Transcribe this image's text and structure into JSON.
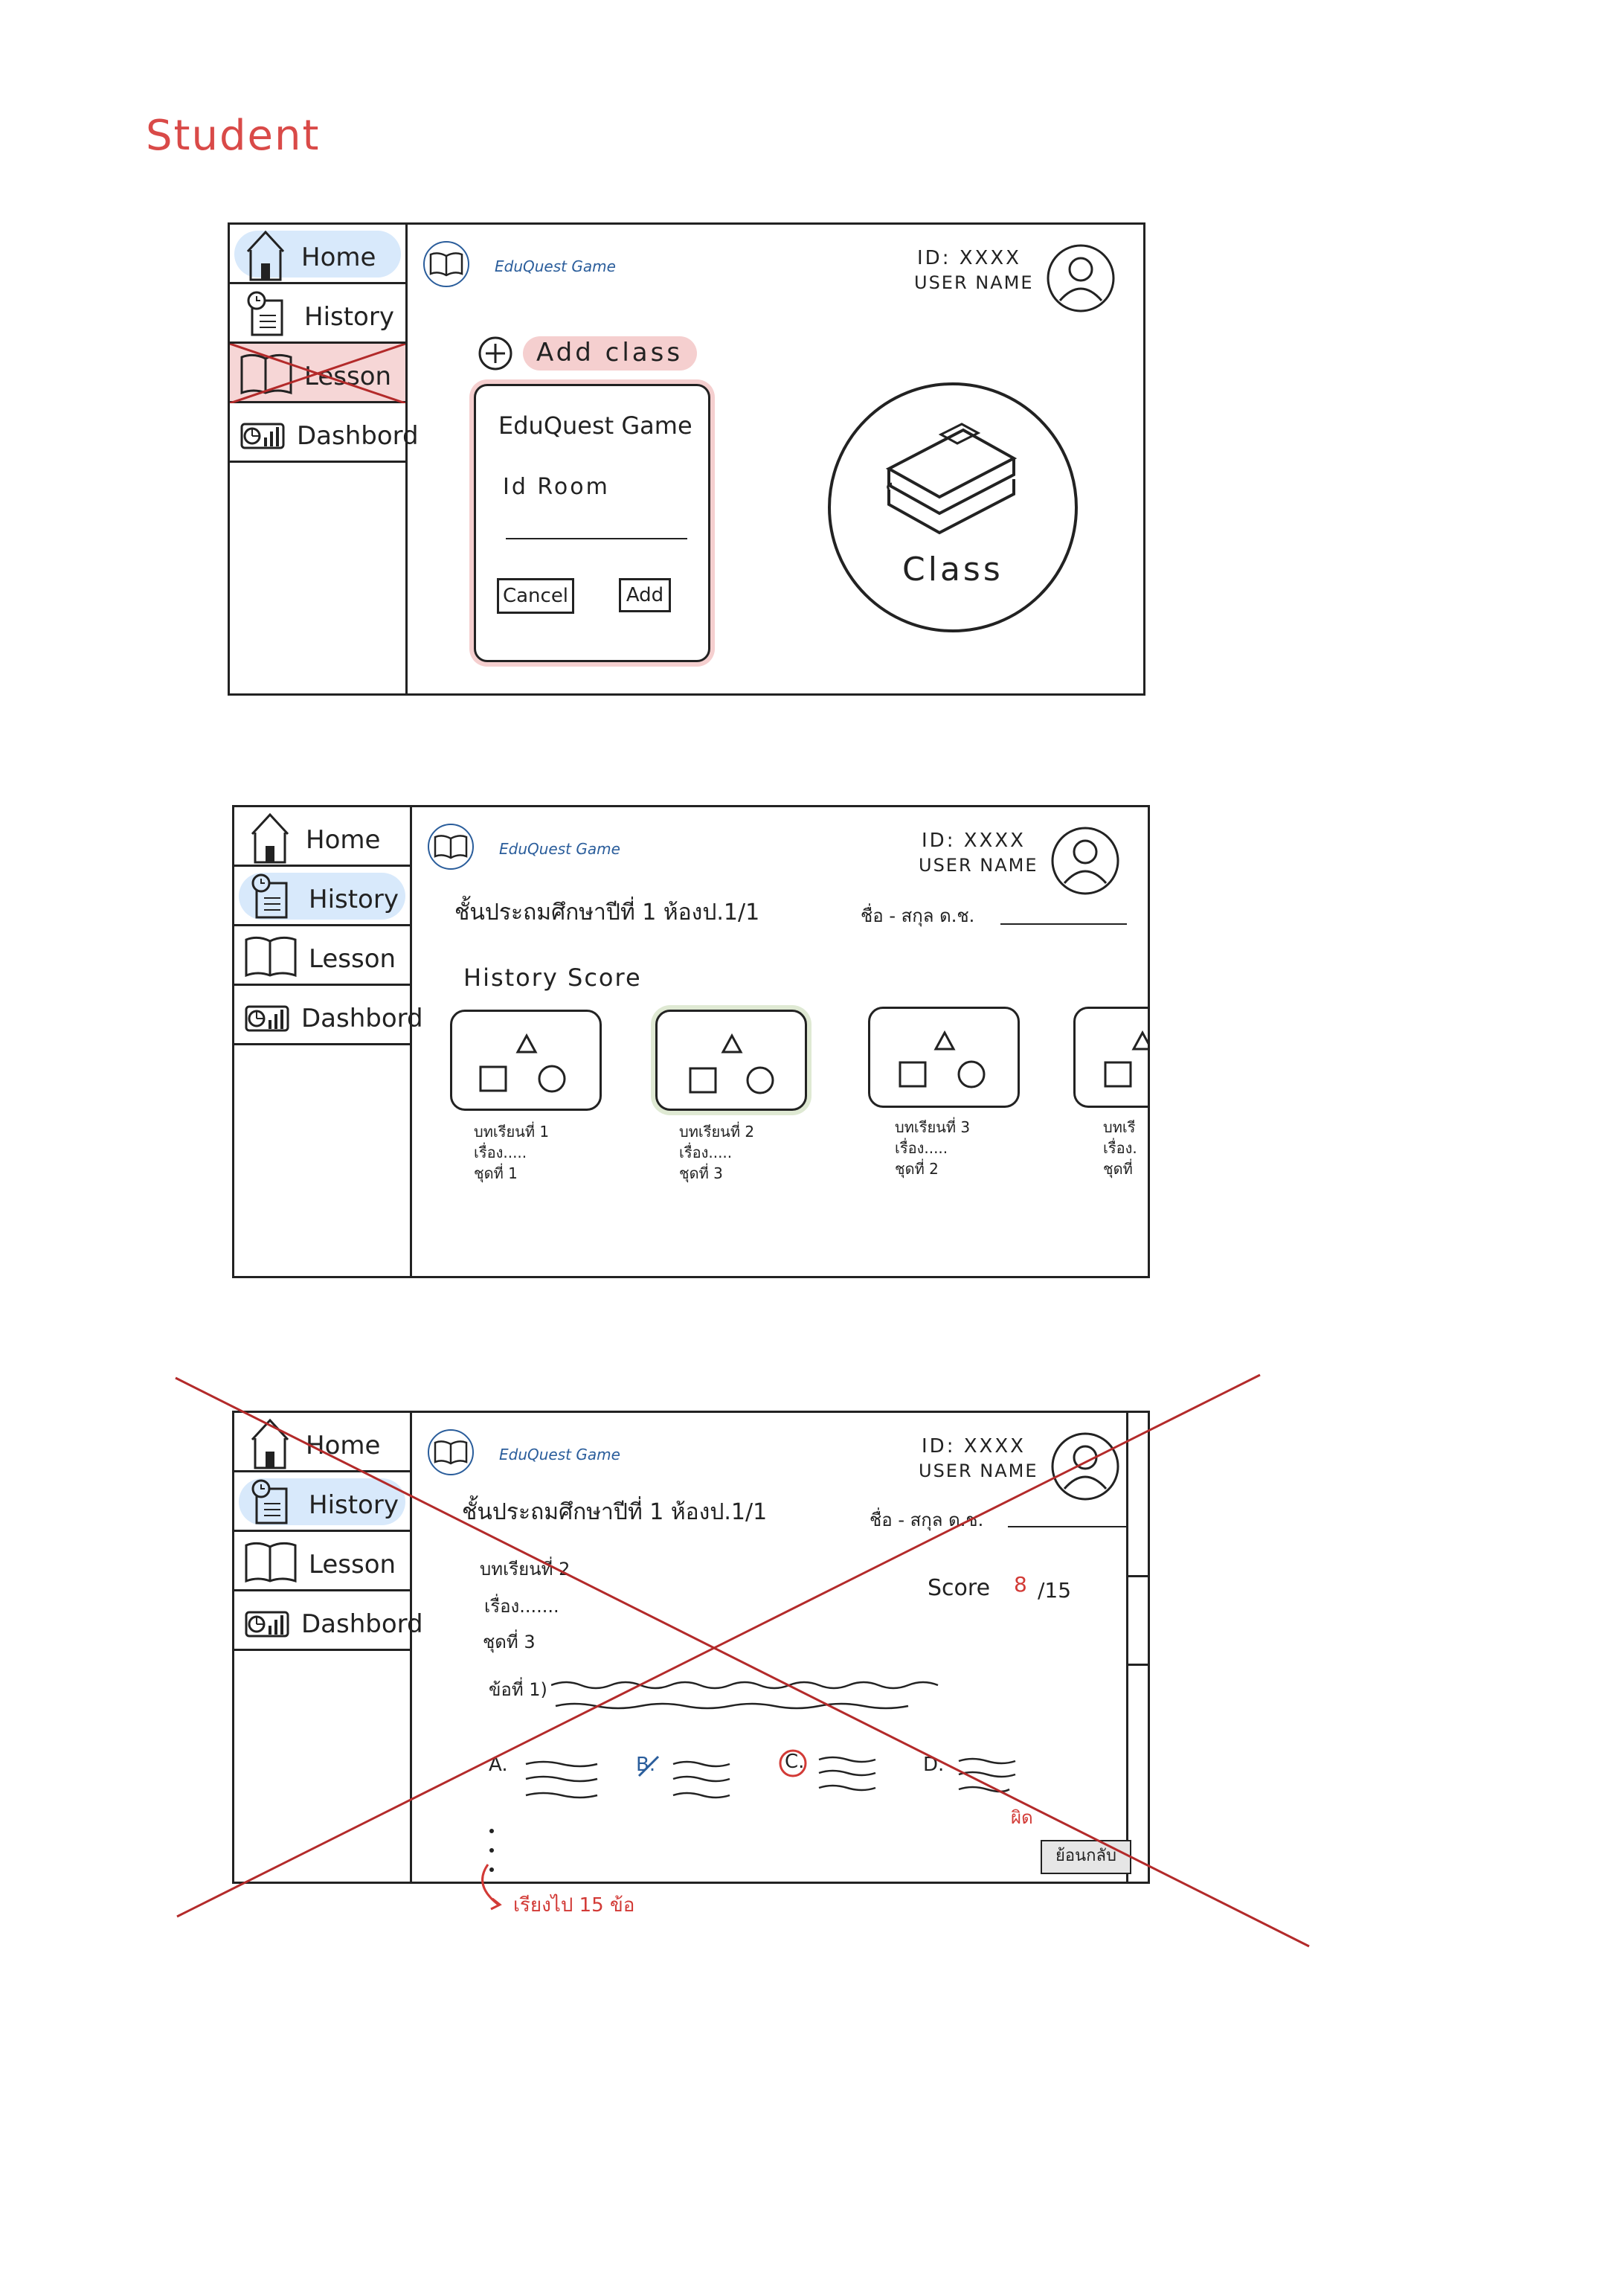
{
  "page_title": "Student",
  "brand": "EduQuest Game",
  "user": {
    "id_label": "ID: XXXX",
    "name_label": "USER NAME"
  },
  "sidebar": {
    "home": "Home",
    "history": "History",
    "lesson": "Lesson",
    "dashboard": "Dashbord"
  },
  "screen1": {
    "add_class_label": "Add class",
    "dialog": {
      "title": "EduQuest Game",
      "field_label": "Id Room",
      "cancel": "Cancel",
      "add": "Add"
    },
    "class_label": "Class"
  },
  "screen2": {
    "class_heading": "ชั้นประถมศึกษาปีที่ 1 ห้องป.1/1",
    "name_heading": "ชื่อ - สกุล ด.ช.",
    "section_title": "History Score",
    "cards": [
      {
        "lesson": "บทเรียนที่ 1",
        "topic": "เรื่อง.....",
        "set": "ชุดที่ 1"
      },
      {
        "lesson": "บทเรียนที่ 2",
        "topic": "เรื่อง.....",
        "set": "ชุดที่ 3"
      },
      {
        "lesson": "บทเรียนที่ 3",
        "topic": "เรื่อง.....",
        "set": "ชุดที่ 2"
      },
      {
        "lesson": "บทเรี",
        "topic": "เรื่อง.",
        "set": "ชุดที่"
      }
    ]
  },
  "screen3": {
    "class_heading": "ชั้นประถมศึกษาปีที่ 1 ห้องป.1/1",
    "name_heading": "ชื่อ - สกุล ด.ช.",
    "lesson": "บทเรียนที่ 2",
    "topic": "เรื่อง.......",
    "set": "ชุดที่ 3",
    "question": "ข้อที่ 1)",
    "score_label": "Score",
    "score_value": "8",
    "score_total": "/15",
    "options": [
      "A.",
      "B.",
      "C.",
      "D."
    ],
    "wrong_note": "ผิด",
    "back_button": "ย้อนกลับ",
    "continue_note": "เรียงไป 15 ข้อ"
  },
  "colors": {
    "accent_red": "#d23a36",
    "highlight_blue": "#d8e9fb",
    "highlight_pink": "#f5cfcf",
    "brand_blue": "#2a5d9b"
  }
}
